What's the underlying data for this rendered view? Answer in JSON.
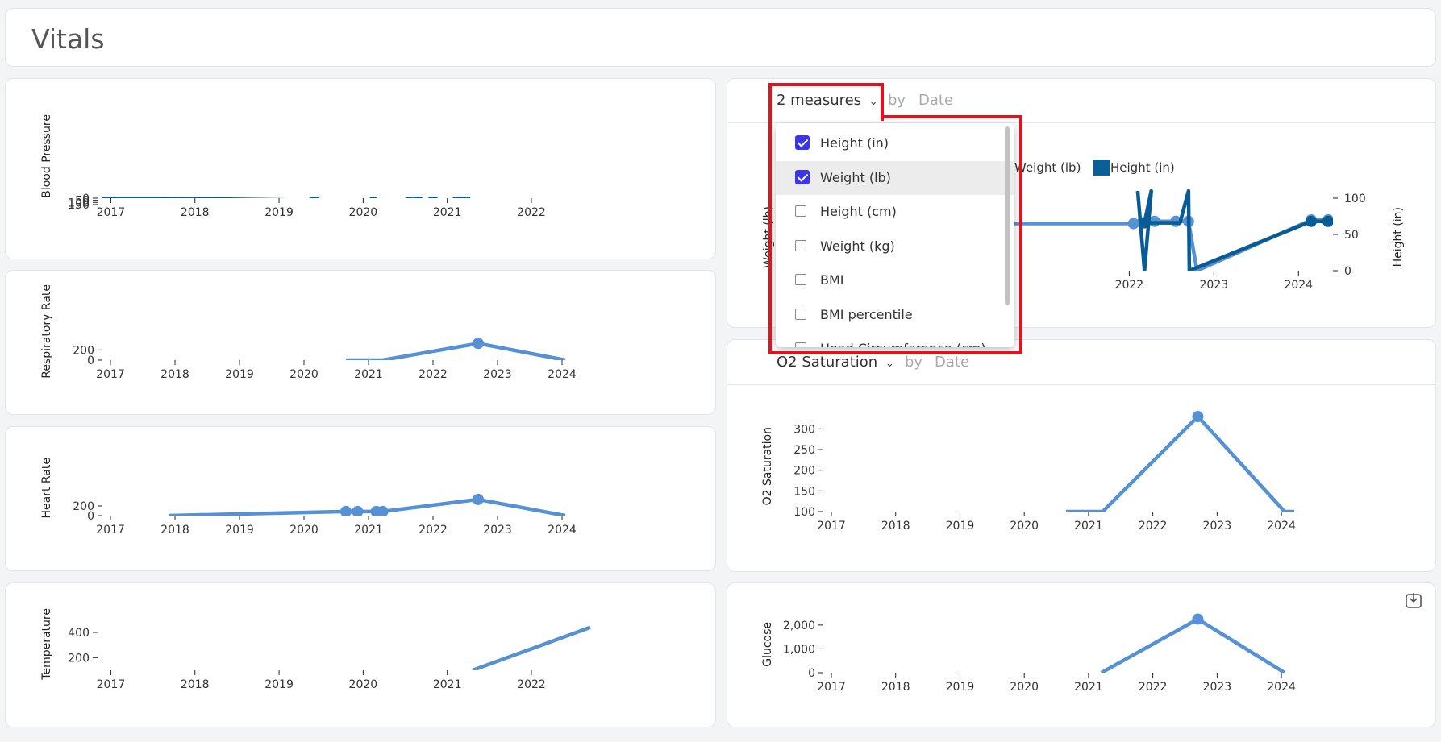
{
  "page_title": "Vitals",
  "measure_selector": {
    "label": "2 measures",
    "by_label": "by",
    "group_by": "Date",
    "options": [
      {
        "label": "Height (in)",
        "checked": true
      },
      {
        "label": "Weight (lb)",
        "checked": true
      },
      {
        "label": "Height (cm)",
        "checked": false
      },
      {
        "label": "Weight (kg)",
        "checked": false
      },
      {
        "label": "BMI",
        "checked": false
      },
      {
        "label": "BMI percentile",
        "checked": false
      },
      {
        "label": "Head Circumference (cm)",
        "checked": false
      }
    ]
  },
  "o2_selector": {
    "label": "O2 Saturation",
    "by_label": "by",
    "group_by": "Date"
  },
  "colors": {
    "light": "#5591d3",
    "dark": "#085b94",
    "highlight": "#e0141e",
    "checkbox": "#3b34e8"
  },
  "icons": {
    "chevron": "chevron-down-icon",
    "download": "download-icon"
  },
  "chart_data": [
    {
      "type": "line",
      "ylabel": "Blood Pressure",
      "xticks": [
        "2017",
        "2018",
        "2019",
        "2020",
        "2021",
        "2022"
      ],
      "yticks": [
        "0",
        "50",
        "100",
        "150"
      ],
      "xlim": [
        2016.9,
        2022.7
      ],
      "ylim": [
        0,
        190
      ],
      "series": [
        {
          "color": "light",
          "fill": true,
          "points": [
            [
              2016.9,
              0
            ],
            [
              2019.42,
              100
            ],
            [
              2020.12,
              182
            ],
            [
              2020.55,
              182
            ],
            [
              2020.65,
              110
            ],
            [
              2020.83,
              110
            ],
            [
              2021.12,
              110
            ],
            [
              2021.22,
              110
            ],
            [
              2022.7,
              120
            ]
          ],
          "markers": [
            [
              2019.42,
              100
            ],
            [
              2020.12,
              182
            ],
            [
              2020.55,
              182
            ],
            [
              2020.65,
              110
            ],
            [
              2020.83,
              110
            ],
            [
              2021.12,
              110
            ],
            [
              2021.22,
              110
            ]
          ]
        },
        {
          "color": "dark",
          "points": [
            [
              2016.9,
              0
            ],
            [
              2017.6,
              5
            ],
            [
              2019.42,
              50
            ],
            [
              2020.12,
              95
            ],
            [
              2020.55,
              95
            ],
            [
              2020.65,
              70
            ],
            [
              2020.83,
              70
            ],
            [
              2021.12,
              70
            ],
            [
              2021.22,
              70
            ],
            [
              2022.7,
              68
            ]
          ],
          "markers": [
            [
              2019.42,
              50
            ],
            [
              2020.12,
              95
            ],
            [
              2020.55,
              95
            ],
            [
              2020.65,
              70
            ],
            [
              2020.83,
              70
            ],
            [
              2021.12,
              70
            ],
            [
              2021.22,
              70
            ]
          ]
        }
      ]
    },
    {
      "type": "line",
      "ylabel": "Respiratory Rate",
      "xticks": [
        "2017",
        "2018",
        "2019",
        "2020",
        "2021",
        "2022",
        "2023",
        "2024"
      ],
      "yticks": [
        "0",
        "200"
      ],
      "xlim": [
        2016.95,
        2024.35
      ],
      "ylim": [
        0,
        350
      ],
      "series": [
        {
          "color": "light",
          "points": [
            [
              2020.65,
              0
            ],
            [
              2020.83,
              0
            ],
            [
              2021.12,
              0
            ],
            [
              2021.22,
              0
            ],
            [
              2022.7,
              330
            ],
            [
              2024.05,
              0
            ]
          ],
          "markers": [
            [
              2022.7,
              330
            ]
          ]
        }
      ]
    },
    {
      "type": "line",
      "ylabel": "Heart Rate",
      "xticks": [
        "2017",
        "2018",
        "2019",
        "2020",
        "2021",
        "2022",
        "2023",
        "2024"
      ],
      "yticks": [
        "0",
        "200"
      ],
      "xlim": [
        2016.95,
        2024.35
      ],
      "ylim": [
        0,
        350
      ],
      "series": [
        {
          "color": "light",
          "points": [
            [
              2017.9,
              0
            ],
            [
              2020.65,
              85
            ],
            [
              2020.83,
              85
            ],
            [
              2021.12,
              85
            ],
            [
              2021.22,
              85
            ],
            [
              2022.7,
              335
            ],
            [
              2024.05,
              0
            ]
          ],
          "markers": [
            [
              2020.65,
              85
            ],
            [
              2020.83,
              85
            ],
            [
              2021.12,
              85
            ],
            [
              2021.22,
              85
            ],
            [
              2022.7,
              335
            ]
          ]
        }
      ]
    },
    {
      "type": "line",
      "ylabel": "Temperature",
      "xticks": [
        "2017",
        "2018",
        "2019",
        "2020",
        "2021",
        "2022"
      ],
      "yticks": [
        "200",
        "400"
      ],
      "xlim": [
        2016.9,
        2022.7
      ],
      "ylim": [
        100,
        470
      ],
      "series": [
        {
          "color": "light",
          "points": [
            [
              2021.3,
              100
            ],
            [
              2022.7,
              440
            ]
          ],
          "markers": []
        }
      ]
    },
    {
      "type": "line",
      "ylabel": "Weight (lb)",
      "y2label": "Height (in)",
      "legend": [
        "Weight (lb)",
        "Height (in)"
      ],
      "xticks": [
        "2022",
        "2023",
        "2024"
      ],
      "y2ticks": [
        "0",
        "50",
        "100"
      ],
      "xlim": [
        2020.3,
        2024.35
      ],
      "ylim": [
        0,
        110
      ],
      "series": [
        {
          "color": "light",
          "points": [
            [
              2020.3,
              65
            ],
            [
              2022.05,
              65
            ],
            [
              2022.15,
              66
            ],
            [
              2022.3,
              68
            ],
            [
              2022.55,
              68
            ],
            [
              2022.7,
              68
            ],
            [
              2022.8,
              0
            ],
            [
              2024.15,
              70
            ],
            [
              2024.35,
              70
            ]
          ],
          "markers": [
            [
              2022.05,
              65
            ],
            [
              2022.15,
              66
            ],
            [
              2022.3,
              68
            ],
            [
              2022.55,
              68
            ],
            [
              2022.7,
              68
            ],
            [
              2024.15,
              70
            ],
            [
              2024.35,
              70
            ]
          ]
        },
        {
          "color": "dark",
          "points": [
            [
              2022.1,
              110
            ],
            [
              2022.18,
              0
            ],
            [
              2022.26,
              110
            ],
            [
              2022.18,
              66
            ],
            [
              2022.6,
              66
            ],
            [
              2022.7,
              110
            ],
            [
              2022.71,
              0
            ],
            [
              2024.15,
              68
            ],
            [
              2024.35,
              68
            ]
          ],
          "markers": [
            [
              2022.18,
              66
            ],
            [
              2024.15,
              68
            ],
            [
              2024.35,
              68
            ]
          ]
        }
      ]
    },
    {
      "type": "line",
      "ylabel": "O2 Saturation",
      "xticks": [
        "2017",
        "2018",
        "2019",
        "2020",
        "2021",
        "2022",
        "2023",
        "2024"
      ],
      "yticks": [
        "100",
        "150",
        "200",
        "250",
        "300"
      ],
      "xlim": [
        2016.95,
        2024.35
      ],
      "ylim": [
        100,
        330
      ],
      "series": [
        {
          "color": "light",
          "points": [
            [
              2020.65,
              100
            ],
            [
              2020.83,
              100
            ],
            [
              2021.12,
              100
            ],
            [
              2021.22,
              100
            ],
            [
              2022.7,
              330
            ],
            [
              2024.05,
              100
            ],
            [
              2024.2,
              100
            ]
          ],
          "markers": [
            [
              2022.7,
              330
            ]
          ]
        }
      ]
    },
    {
      "type": "line",
      "ylabel": "Glucose",
      "xticks": [
        "2017",
        "2018",
        "2019",
        "2020",
        "2021",
        "2022",
        "2023",
        "2024"
      ],
      "yticks": [
        "0",
        "1,000",
        "2,000"
      ],
      "xlim": [
        2016.95,
        2024.35
      ],
      "ylim": [
        0,
        2300
      ],
      "series": [
        {
          "color": "light",
          "points": [
            [
              2021.2,
              0
            ],
            [
              2022.7,
              2250
            ],
            [
              2024.05,
              0
            ]
          ],
          "markers": [
            [
              2022.7,
              2250
            ]
          ]
        }
      ]
    }
  ]
}
